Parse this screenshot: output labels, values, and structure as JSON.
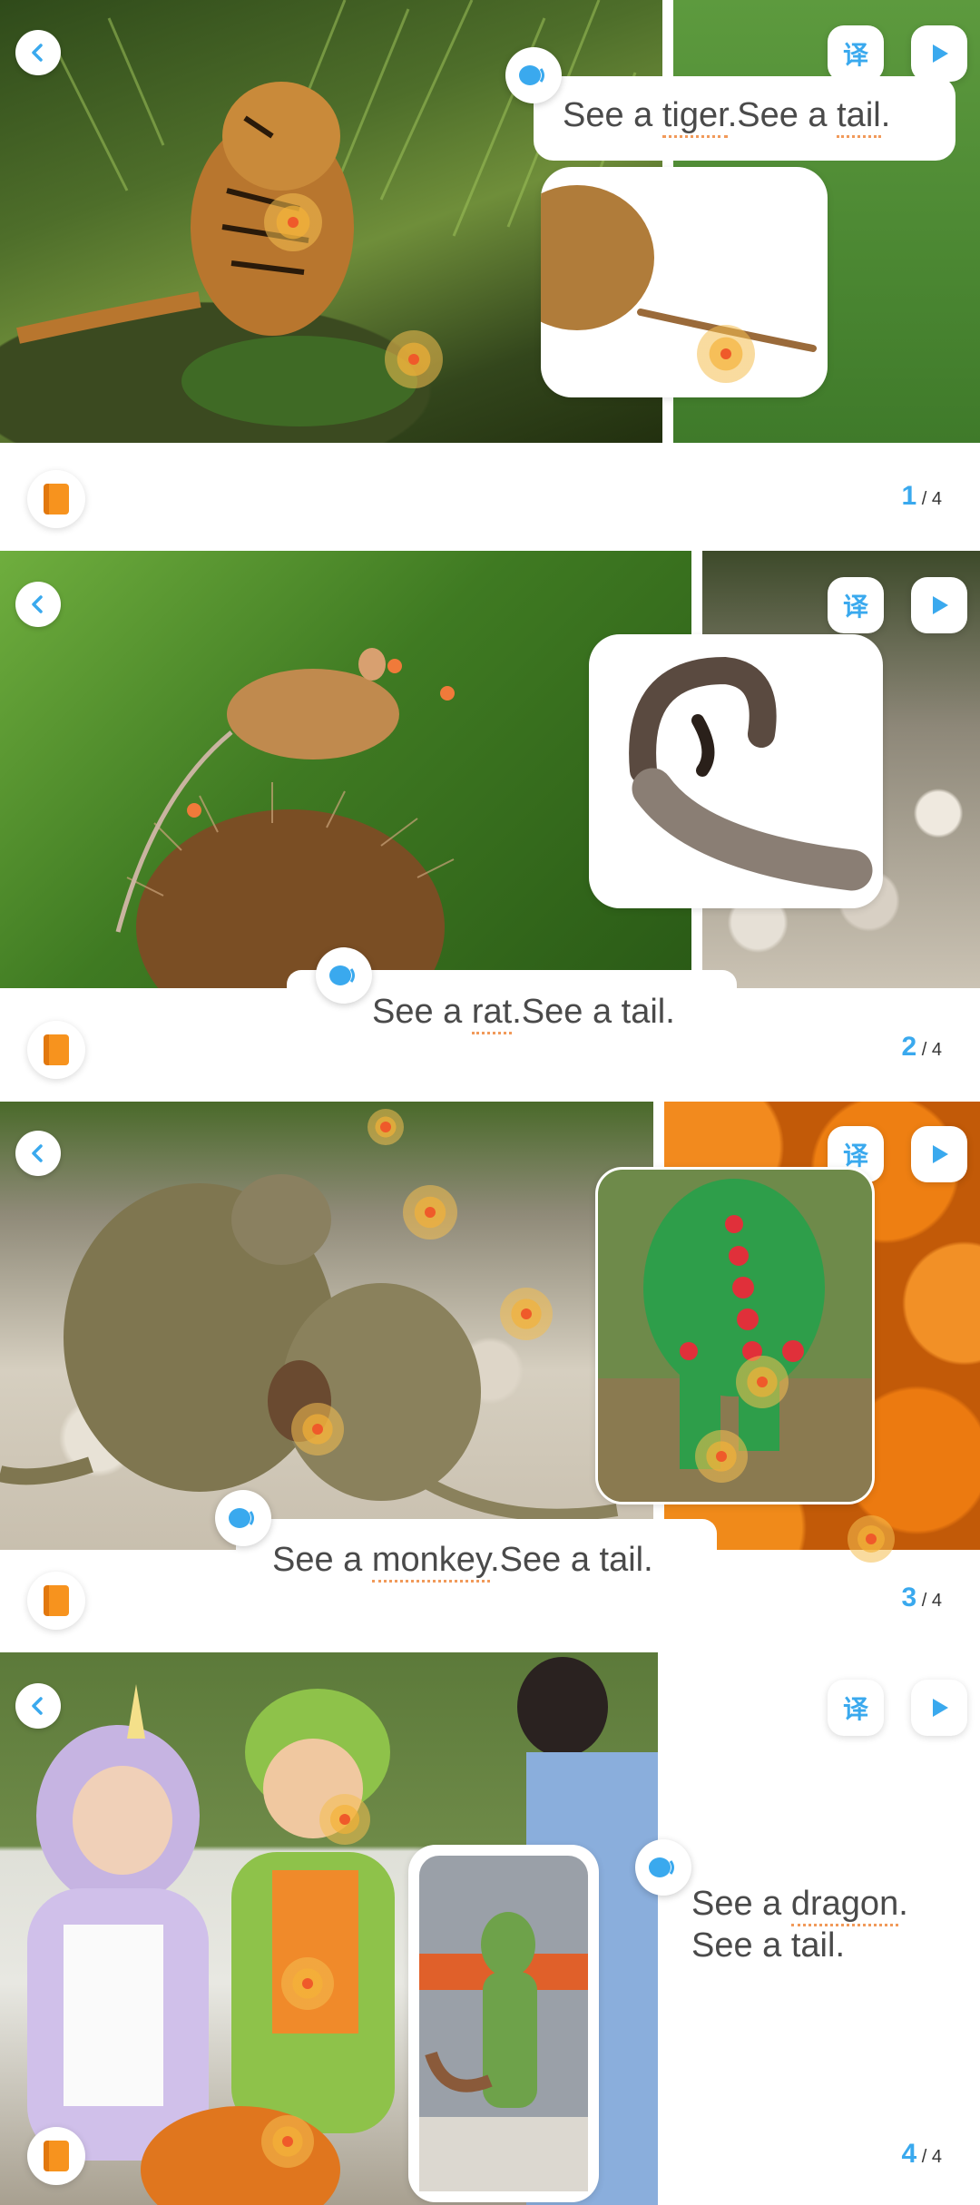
{
  "pages": [
    {
      "sentence": {
        "pre": "See a ",
        "word": "tiger",
        "post": ".See a ",
        "word2": "tail",
        "end": "."
      },
      "page_current": "1",
      "page_total": "/ 4"
    },
    {
      "sentence": {
        "pre": "See a ",
        "word": "rat",
        "post": ".See a tail."
      },
      "page_current": "2",
      "page_total": "/ 4"
    },
    {
      "sentence": {
        "pre": "See a ",
        "word": "monkey",
        "post": ".See a tail."
      },
      "page_current": "3",
      "page_total": "/ 4"
    },
    {
      "sentence": {
        "line1_pre": "See a ",
        "word": "dragon",
        "line1_end": ".",
        "line2": "See a tail."
      },
      "page_current": "4",
      "page_total": "/ 4"
    }
  ],
  "controls": {
    "translate_label": "译",
    "back_icon": "chevron-left-icon",
    "play_icon": "play-icon",
    "audio_icon": "speaker-icon",
    "book_icon": "book-icon"
  },
  "colors": {
    "accent": "#3aa9ee",
    "highlight_underline": "#f19a5a",
    "book_orange": "#f7931e",
    "hotspot": "#f4b43c"
  }
}
